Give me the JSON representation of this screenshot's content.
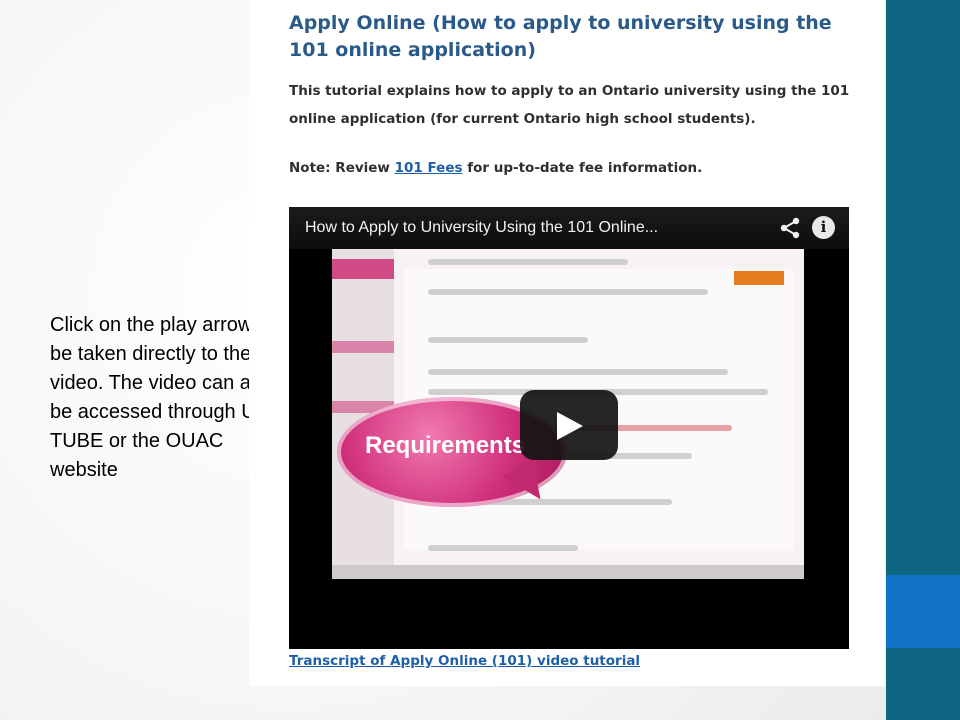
{
  "slide": {
    "caption": "Click on the play arrow to be taken directly to the video. The video can also be accessed through U-TUBE or the OUAC website",
    "colors": {
      "accent_bar": "#0f6682",
      "accent_block": "#1173c6"
    }
  },
  "webpage": {
    "title": "Apply Online (How to apply to university using the 101 online application)",
    "intro": "This tutorial explains how to apply to an Ontario university using the 101 online application (for current Ontario high school students).",
    "note_label": "Note:",
    "note_before_link": " Review ",
    "note_link": "101 Fees",
    "note_after_link": " for up-to-date fee information.",
    "transcript_link": "Transcript of Apply Online (101) video tutorial"
  },
  "video": {
    "title": "How to Apply to University Using the 101 Online...",
    "bubble_text": "Requirements",
    "icons": {
      "share": "share-icon",
      "info": "info-icon",
      "play": "play-icon"
    }
  }
}
